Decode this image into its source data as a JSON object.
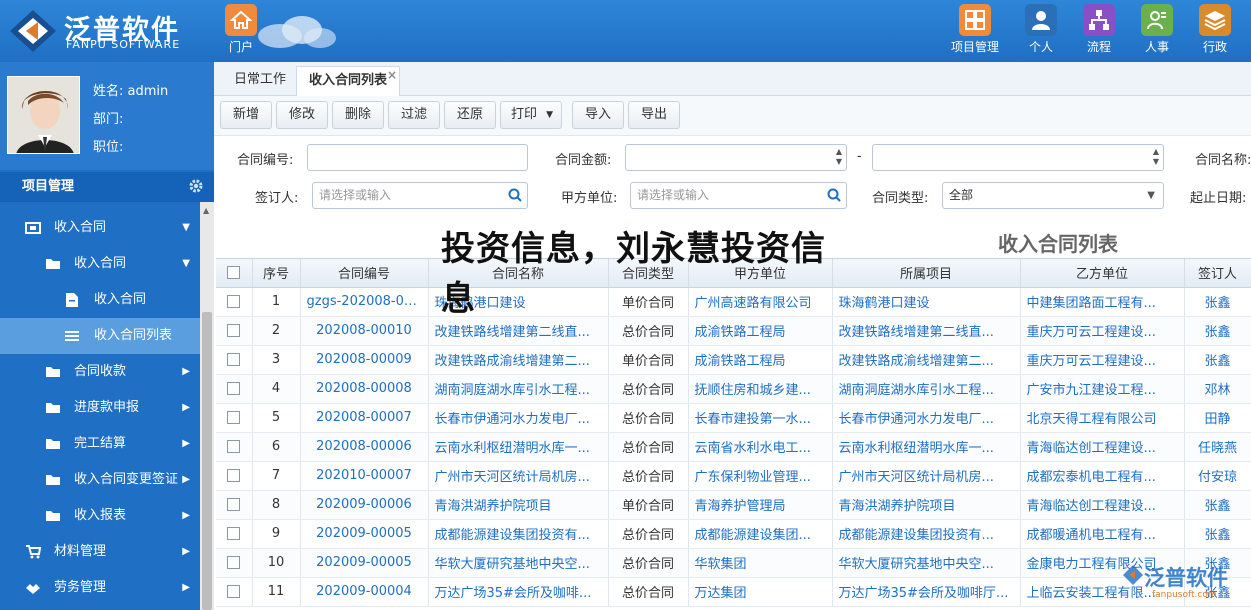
{
  "brand": {
    "name_cn": "泛普软件",
    "name_en": "FANPU SOFTWARE"
  },
  "portal": {
    "label": "门户"
  },
  "top_nav": [
    {
      "label": "项目管理",
      "icon": "grid-icon",
      "color": "#f08a3c"
    },
    {
      "label": "个人",
      "icon": "person-icon",
      "color": "#2b6fb8"
    },
    {
      "label": "流程",
      "icon": "flow-icon",
      "color": "#8a4fc6"
    },
    {
      "label": "人事",
      "icon": "user-edit-icon",
      "color": "#6ab04c"
    },
    {
      "label": "行政",
      "icon": "layers-icon",
      "color": "#d98a2b"
    }
  ],
  "profile": {
    "name_label": "姓名: admin",
    "dept_label": "部门:",
    "title_label": "职位:"
  },
  "sidebar": {
    "section": "项目管理",
    "items": [
      {
        "label": "收入合同",
        "level": 0,
        "arrow": "▼"
      },
      {
        "label": "收入合同",
        "level": 1,
        "arrow": "▼"
      },
      {
        "label": "收入合同",
        "level": 2,
        "arrow": ""
      },
      {
        "label": "收入合同列表",
        "level": 2,
        "arrow": "",
        "active": true
      },
      {
        "label": "合同收款",
        "level": 1,
        "arrow": "▶"
      },
      {
        "label": "进度款申报",
        "level": 1,
        "arrow": "▶"
      },
      {
        "label": "完工结算",
        "level": 1,
        "arrow": "▶"
      },
      {
        "label": "收入合同变更签证",
        "level": 1,
        "arrow": "▶"
      },
      {
        "label": "收入报表",
        "level": 1,
        "arrow": "▶"
      },
      {
        "label": "材料管理",
        "level": 0,
        "arrow": "▶"
      },
      {
        "label": "劳务管理",
        "level": 0,
        "arrow": "▶"
      }
    ]
  },
  "tabs": [
    {
      "label": "日常工作"
    },
    {
      "label": "收入合同列表",
      "close": "×"
    }
  ],
  "toolbar": [
    "新增",
    "修改",
    "删除",
    "过滤",
    "还原",
    "打印",
    "导入",
    "导出"
  ],
  "filters": {
    "contract_no": "合同编号:",
    "amount": "合同金额:",
    "amount_sep": "-",
    "contract_name": "合同名称:",
    "signer": "签订人:",
    "signer_placeholder": "请选择或输入",
    "party_a": "甲方单位:",
    "party_a_placeholder": "请选择或输入",
    "contract_type": "合同类型:",
    "contract_type_value": "全部",
    "date_range": "起止日期:"
  },
  "list_title": "收入合同列表",
  "table": {
    "headers": [
      "序号",
      "合同编号",
      "合同名称",
      "合同类型",
      "甲方单位",
      "所属项目",
      "乙方单位",
      "签订人"
    ],
    "rows": [
      [
        "1",
        "gzgs-202008-00...",
        "珠海鹤港口建设",
        "单价合同",
        "广州高速路有限公司",
        "珠海鹤港口建设",
        "中建集团路面工程有...",
        "张鑫"
      ],
      [
        "2",
        "202008-00010",
        "改建铁路线增建第二线直...",
        "总价合同",
        "成渝铁路工程局",
        "改建铁路线增建第二线直...",
        "重庆万可云工程建设...",
        "张鑫"
      ],
      [
        "3",
        "202008-00009",
        "改建铁路成渝线增建第二...",
        "单价合同",
        "成渝铁路工程局",
        "改建铁路成渝线增建第二...",
        "重庆万可云工程建设...",
        "张鑫"
      ],
      [
        "4",
        "202008-00008",
        "湖南洞庭湖水库引水工程...",
        "总价合同",
        "抚顺住房和城乡建...",
        "湖南洞庭湖水库引水工程...",
        "广安市九江建设工程...",
        "邓林"
      ],
      [
        "5",
        "202008-00007",
        "长春市伊通河水力发电厂...",
        "总价合同",
        "长春市建投第一水...",
        "长春市伊通河水力发电厂...",
        "北京天得工程有限公司",
        "田静"
      ],
      [
        "6",
        "202008-00006",
        "云南水利枢纽潜明水库一...",
        "总价合同",
        "云南省水利水电工...",
        "云南水利枢纽潜明水库一...",
        "青海临达创工程建设...",
        "任晓燕"
      ],
      [
        "7",
        "202010-00007",
        "广州市天河区统计局机房...",
        "总价合同",
        "广东保利物业管理...",
        "广州市天河区统计局机房...",
        "成都宏泰机电工程有...",
        "付安琼"
      ],
      [
        "8",
        "202009-00006",
        "青海洪湖养护院项目",
        "单价合同",
        "青海养护管理局",
        "青海洪湖养护院项目",
        "青海临达创工程建设...",
        "张鑫"
      ],
      [
        "9",
        "202009-00005",
        "成都能源建设集团投资有...",
        "总价合同",
        "成都能源建设集团...",
        "成都能源建设集团投资有...",
        "成都暖通机电工程有...",
        "张鑫"
      ],
      [
        "10",
        "202009-00005",
        "华软大厦研究基地中央空...",
        "总价合同",
        "华软集团",
        "华软大厦研究基地中央空...",
        "金康电力工程有限公司",
        "张鑫"
      ],
      [
        "11",
        "202009-00004",
        "万达广场35#会所及咖啡...",
        "总价合同",
        "万达集团",
        "万达广场35#会所及咖啡厅...",
        "上临云安装工程有限...",
        "张鑫"
      ]
    ]
  },
  "overlay_title": "投资信息，刘永慧投资信息",
  "watermark": {
    "text": "泛普软件",
    "url": "fanpusoft.com"
  }
}
